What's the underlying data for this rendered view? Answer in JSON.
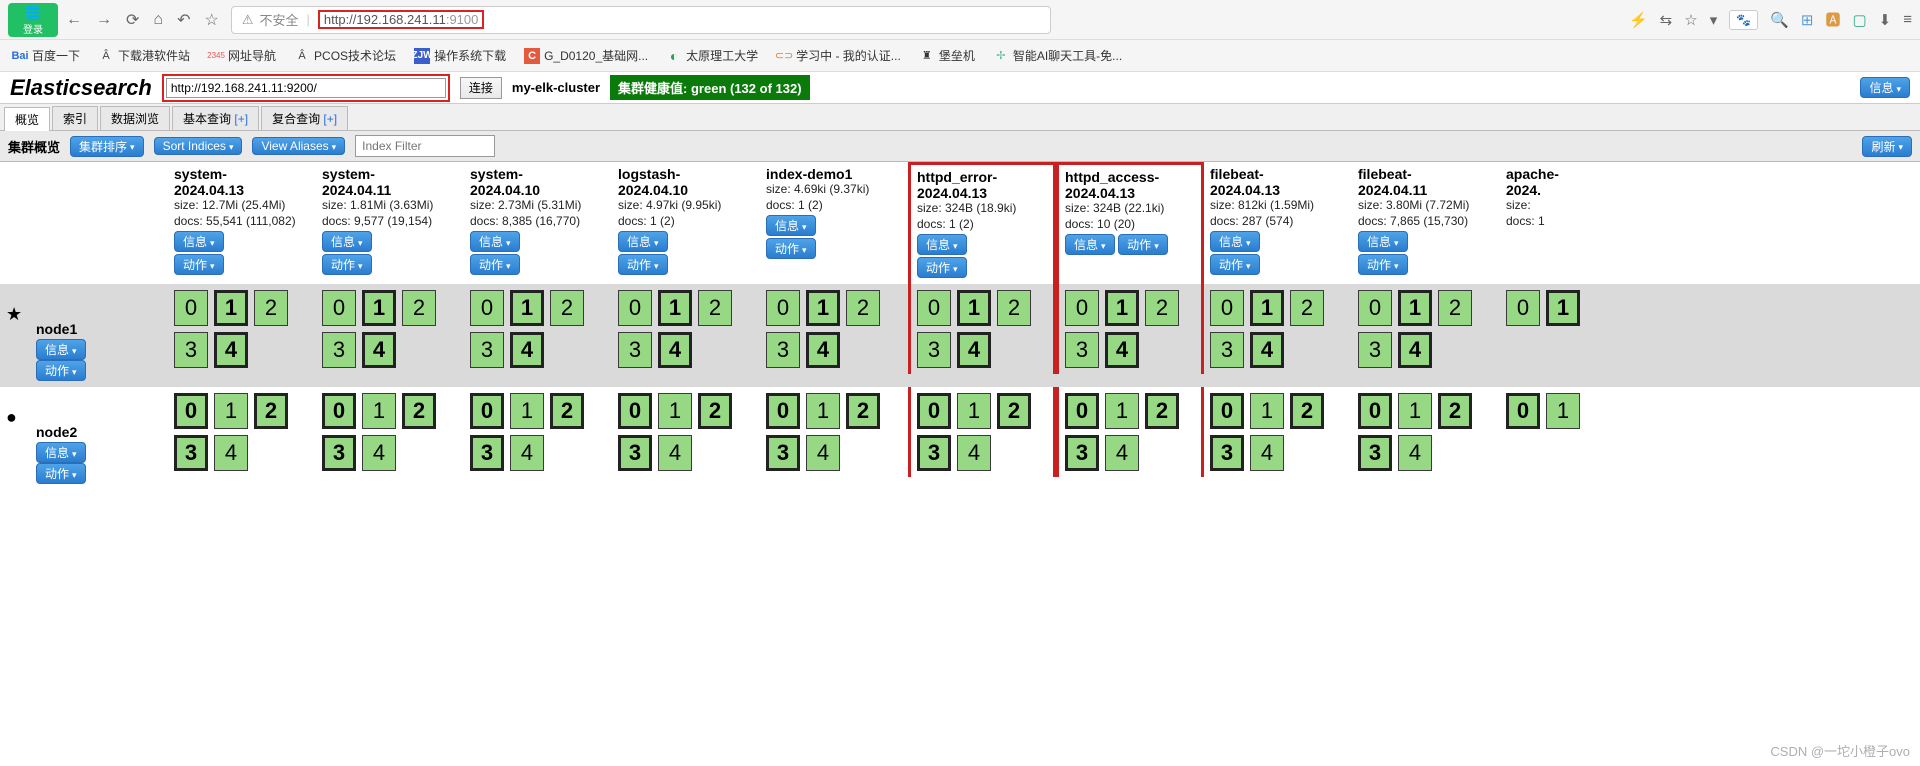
{
  "browser": {
    "login": "登录",
    "insecure": "不安全",
    "url_host": "192.168.241.11",
    "url_port": ":9100",
    "url_prefix": "http://",
    "baidu_label": "百度"
  },
  "bookmarks": [
    {
      "icon": "baidu",
      "label": "百度一下"
    },
    {
      "icon": "A",
      "label": "下载港软件站"
    },
    {
      "icon": "2345",
      "label": "网址导航"
    },
    {
      "icon": "A",
      "label": "PCOS技术论坛"
    },
    {
      "icon": "zjw",
      "label": "操作系统下载"
    },
    {
      "icon": "C",
      "label": "G_D0120_基础网..."
    },
    {
      "icon": "O",
      "label": "太原理工大学"
    },
    {
      "icon": "CO",
      "label": "学习中 - 我的认证..."
    },
    {
      "icon": "rook",
      "label": "堡垒机"
    },
    {
      "icon": "ai",
      "label": "智能AI聊天工具-免..."
    }
  ],
  "es": {
    "title": "Elasticsearch",
    "conn_url": "http://192.168.241.11:9200/",
    "connect_btn": "连接",
    "cluster_name": "my-elk-cluster",
    "health": "集群健康值: green (132 of 132)",
    "info_btn": "信息",
    "refresh_btn": "刷新"
  },
  "tabs": [
    {
      "label": "概览",
      "active": true
    },
    {
      "label": "索引"
    },
    {
      "label": "数据浏览"
    },
    {
      "label": "基本查询 [+]"
    },
    {
      "label": "复合查询 [+]"
    }
  ],
  "toolbar": {
    "title": "集群概览",
    "cluster_sort": "集群排序",
    "sort_indices": "Sort Indices",
    "view_aliases": "View Aliases",
    "filter_placeholder": "Index Filter"
  },
  "btns": {
    "info": "信息",
    "action": "动作"
  },
  "indices": [
    {
      "name": "system-2024.04.13",
      "size": "size: 12.7Mi (25.4Mi)",
      "docs": "docs: 55,541 (111,082)",
      "shards": 5,
      "hl": false
    },
    {
      "name": "system-2024.04.11",
      "size": "size: 1.81Mi (3.63Mi)",
      "docs": "docs: 9,577 (19,154)",
      "shards": 5,
      "hl": false
    },
    {
      "name": "system-2024.04.10",
      "size": "size: 2.73Mi (5.31Mi)",
      "docs": "docs: 8,385 (16,770)",
      "shards": 5,
      "hl": false
    },
    {
      "name": "logstash-2024.04.10",
      "size": "size: 4.97ki (9.95ki)",
      "docs": "docs: 1 (2)",
      "shards": 5,
      "hl": false
    },
    {
      "name": "index-demo1",
      "size": "size: 4.69ki (9.37ki)",
      "docs": "docs: 1 (2)",
      "shards": 5,
      "hl": false
    },
    {
      "name": "httpd_error-2024.04.13",
      "size": "size: 324B (18.9ki)",
      "docs": "docs: 1 (2)",
      "shards": 5,
      "hl": true
    },
    {
      "name": "httpd_access-2024.04.13",
      "size": "size: 324B (22.1ki)",
      "docs": "docs: 10 (20)",
      "shards": 5,
      "hl": true,
      "inline_btns": true
    },
    {
      "name": "filebeat-2024.04.13",
      "size": "size: 812ki (1.59Mi)",
      "docs": "docs: 287 (574)",
      "shards": 5,
      "hl": false
    },
    {
      "name": "filebeat-2024.04.11",
      "size": "size: 3.80Mi (7.72Mi)",
      "docs": "docs: 7,865 (15,730)",
      "shards": 5,
      "hl": false
    },
    {
      "name": "apache-2024.",
      "size": "size:",
      "docs": "docs: 1",
      "shards": 2,
      "hl": false,
      "partial": true
    }
  ],
  "nodes": [
    {
      "symbol": "★",
      "sclass": "node-star",
      "name": "node1",
      "primaryRow": [
        1,
        4
      ],
      "row_bg": "shard-row-bg1"
    },
    {
      "symbol": "●",
      "sclass": "node-circle",
      "name": "node2",
      "primaryRow": [
        0,
        2,
        3
      ],
      "row_bg": ""
    }
  ],
  "watermark": "CSDN @一坨小橙子ovo"
}
